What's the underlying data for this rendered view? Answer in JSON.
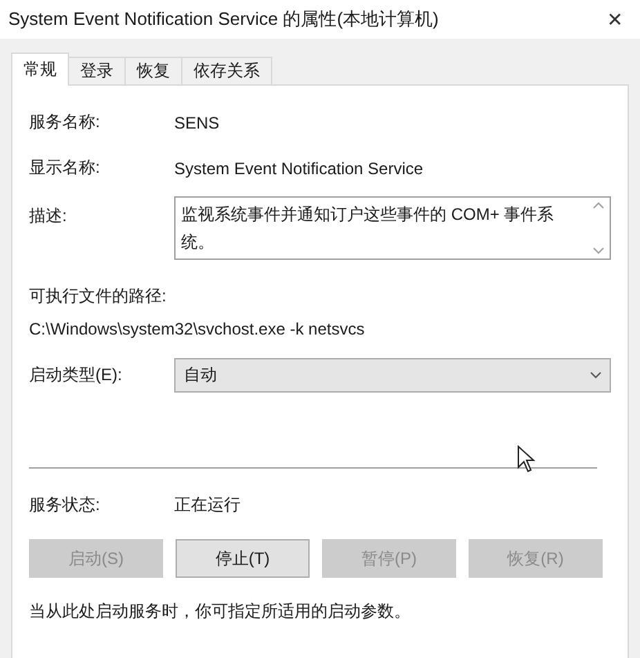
{
  "window": {
    "title": "System Event Notification Service 的属性(本地计算机)",
    "close": "✕"
  },
  "tabs": [
    {
      "label": "常规",
      "selected": true
    },
    {
      "label": "登录",
      "selected": false
    },
    {
      "label": "恢复",
      "selected": false
    },
    {
      "label": "依存关系",
      "selected": false
    }
  ],
  "service_name": {
    "label": "服务名称:",
    "value": "SENS"
  },
  "display_name": {
    "label": "显示名称:",
    "value": "System Event Notification Service"
  },
  "description": {
    "label": "描述:",
    "value": "监视系统事件并通知订户这些事件的 COM+ 事件系统。"
  },
  "executable_path": {
    "label": "可执行文件的路径:",
    "value": "C:\\Windows\\system32\\svchost.exe -k netsvcs"
  },
  "startup_type": {
    "label": "启动类型(E):",
    "value": "自动"
  },
  "service_status": {
    "label": "服务状态:",
    "value": "正在运行"
  },
  "buttons": [
    {
      "label": "启动(S)",
      "disabled": true
    },
    {
      "label": "停止(T)",
      "disabled": false
    },
    {
      "label": "暂停(P)",
      "disabled": true
    },
    {
      "label": "恢复(R)",
      "disabled": true
    }
  ],
  "note": "当从此处启动服务时，你可指定所适用的启动参数。"
}
